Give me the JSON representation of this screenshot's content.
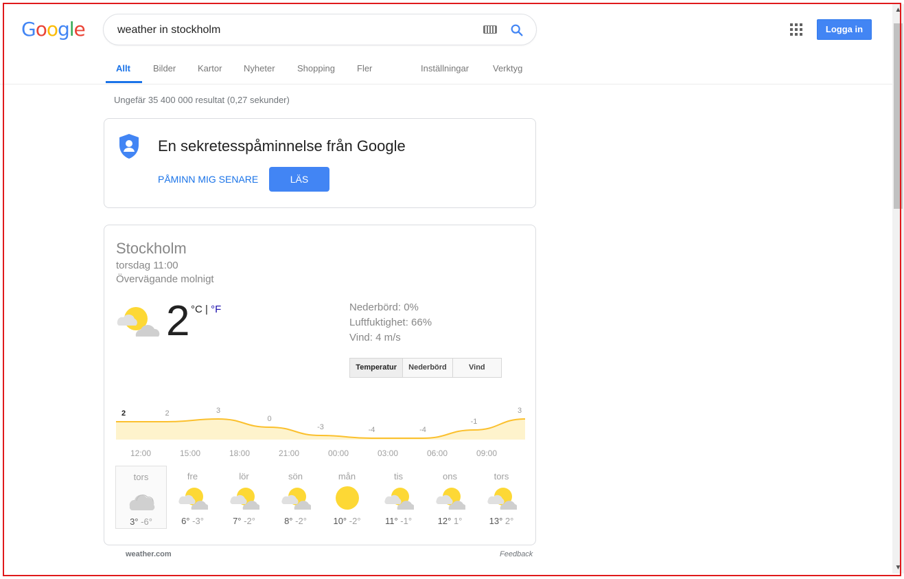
{
  "logo": "Google",
  "search": {
    "query": "weather in stockholm"
  },
  "header": {
    "signin_label": "Logga in"
  },
  "tabs": [
    {
      "label": "Allt",
      "active": true
    },
    {
      "label": "Bilder"
    },
    {
      "label": "Kartor"
    },
    {
      "label": "Nyheter"
    },
    {
      "label": "Shopping"
    },
    {
      "label": "Fler"
    },
    {
      "label": "Inställningar"
    },
    {
      "label": "Verktyg"
    }
  ],
  "result_stats": "Ungefär 35 400 000 resultat (0,27 sekunder)",
  "privacy": {
    "title": "En sekretesspåminnelse från Google",
    "remind_label": "PÅMINN MIG SENARE",
    "read_label": "LÄS"
  },
  "weather": {
    "city": "Stockholm",
    "time": "torsdag 11:00",
    "condition": "Övervägande molnigt",
    "temp": "2",
    "unit_c": "°C",
    "unit_sep": " | ",
    "unit_f": "°F",
    "precip": "Nederbörd: 0%",
    "humidity": "Luftfuktighet: 66%",
    "wind": "Vind: 4 m/s",
    "toggle": [
      "Temperatur",
      "Nederbörd",
      "Vind"
    ],
    "hours": [
      "12:00",
      "15:00",
      "18:00",
      "21:00",
      "00:00",
      "03:00",
      "06:00",
      "09:00"
    ],
    "days": [
      {
        "name": "tors",
        "hi": "3°",
        "lo": "-6°",
        "icon": "cloudy-icon"
      },
      {
        "name": "fre",
        "hi": "6°",
        "lo": "-3°",
        "icon": "partly-cloudy-icon"
      },
      {
        "name": "lör",
        "hi": "7°",
        "lo": "-2°",
        "icon": "partly-cloudy-icon"
      },
      {
        "name": "sön",
        "hi": "8°",
        "lo": "-2°",
        "icon": "partly-cloudy-icon"
      },
      {
        "name": "mån",
        "hi": "10°",
        "lo": "-2°",
        "icon": "sunny-icon"
      },
      {
        "name": "tis",
        "hi": "11°",
        "lo": "-1°",
        "icon": "partly-cloudy-icon"
      },
      {
        "name": "ons",
        "hi": "12°",
        "lo": "1°",
        "icon": "partly-cloudy-icon"
      },
      {
        "name": "tors",
        "hi": "13°",
        "lo": "2°",
        "icon": "partly-cloudy-icon"
      }
    ],
    "source": "weather.com",
    "feedback": "Feedback"
  },
  "chart_data": {
    "type": "area",
    "x": [
      "12:00",
      "15:00",
      "18:00",
      "21:00",
      "00:00",
      "03:00",
      "06:00",
      "09:00",
      "12:00"
    ],
    "labels": [
      "2",
      "2",
      "3",
      "0",
      "-3",
      "-4",
      "-4",
      "-1",
      "3"
    ],
    "values": [
      2,
      2,
      3,
      0,
      -3,
      -4,
      -4,
      -1,
      3
    ],
    "color": "#fbc02d",
    "fill": "#fef3cc"
  },
  "colors": {
    "accent": "#1a73e8",
    "button": "#4285f4"
  }
}
